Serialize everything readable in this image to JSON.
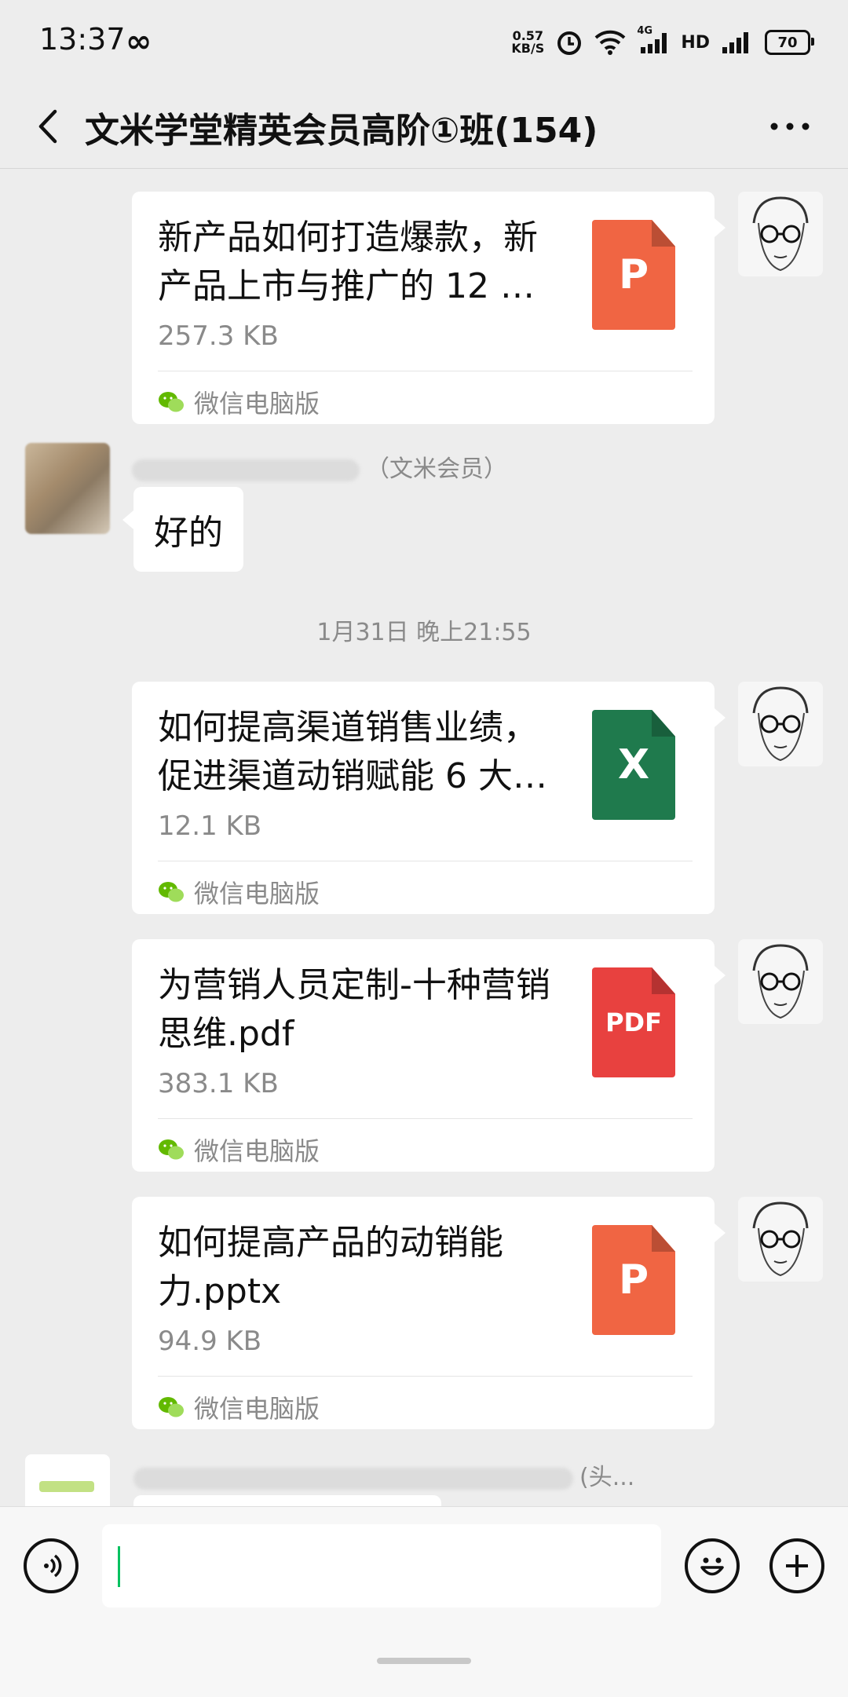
{
  "status_bar": {
    "time": "13:37",
    "loop_glyph": "∞",
    "net_speed_value": "0.57",
    "net_speed_unit": "KB/S",
    "network": "4G",
    "hd": "HD",
    "battery": "70"
  },
  "header": {
    "title": "文米学堂精英会员高阶①班(154)",
    "back_icon": "chevron-left-icon",
    "more_icon": "more-dots-icon"
  },
  "messages": [
    {
      "type": "file",
      "side": "right",
      "name": "新产品如何打造爆款，新产品上市与推广的 12 …",
      "size": "257.3 KB",
      "icon_letter": "P",
      "icon_color": "#f06543",
      "source": "微信电脑版"
    },
    {
      "type": "text",
      "side": "left",
      "sender_suffix": "（文米会员）",
      "text": "好的"
    },
    {
      "type": "timestamp",
      "text": "1月31日 晚上21:55"
    },
    {
      "type": "file",
      "side": "right",
      "name": "如何提高渠道销售业绩，促进渠道动销赋能 6 大…",
      "size": "12.1 KB",
      "icon_letter": "X",
      "icon_color": "#1f7a4d",
      "source": "微信电脑版"
    },
    {
      "type": "file",
      "side": "right",
      "name": "为营销人员定制-十种营销思维.pdf",
      "size": "383.1 KB",
      "icon_letter": "PDF",
      "icon_color": "#e8413f",
      "source": "微信电脑版"
    },
    {
      "type": "file",
      "side": "right",
      "name": "如何提高产品的动销能力.pptx",
      "size": "94.9 KB",
      "icon_letter": "P",
      "icon_color": "#f06543",
      "source": "微信电脑版"
    },
    {
      "type": "partial",
      "side": "left",
      "sender_partial": "(头..."
    }
  ],
  "input_bar": {
    "voice_icon": "voice-icon",
    "emoji_icon": "emoji-icon",
    "plus_icon": "plus-icon"
  },
  "colors": {
    "background": "#ededed",
    "accent": "#07c160",
    "wechat_logo": "#62b900"
  }
}
